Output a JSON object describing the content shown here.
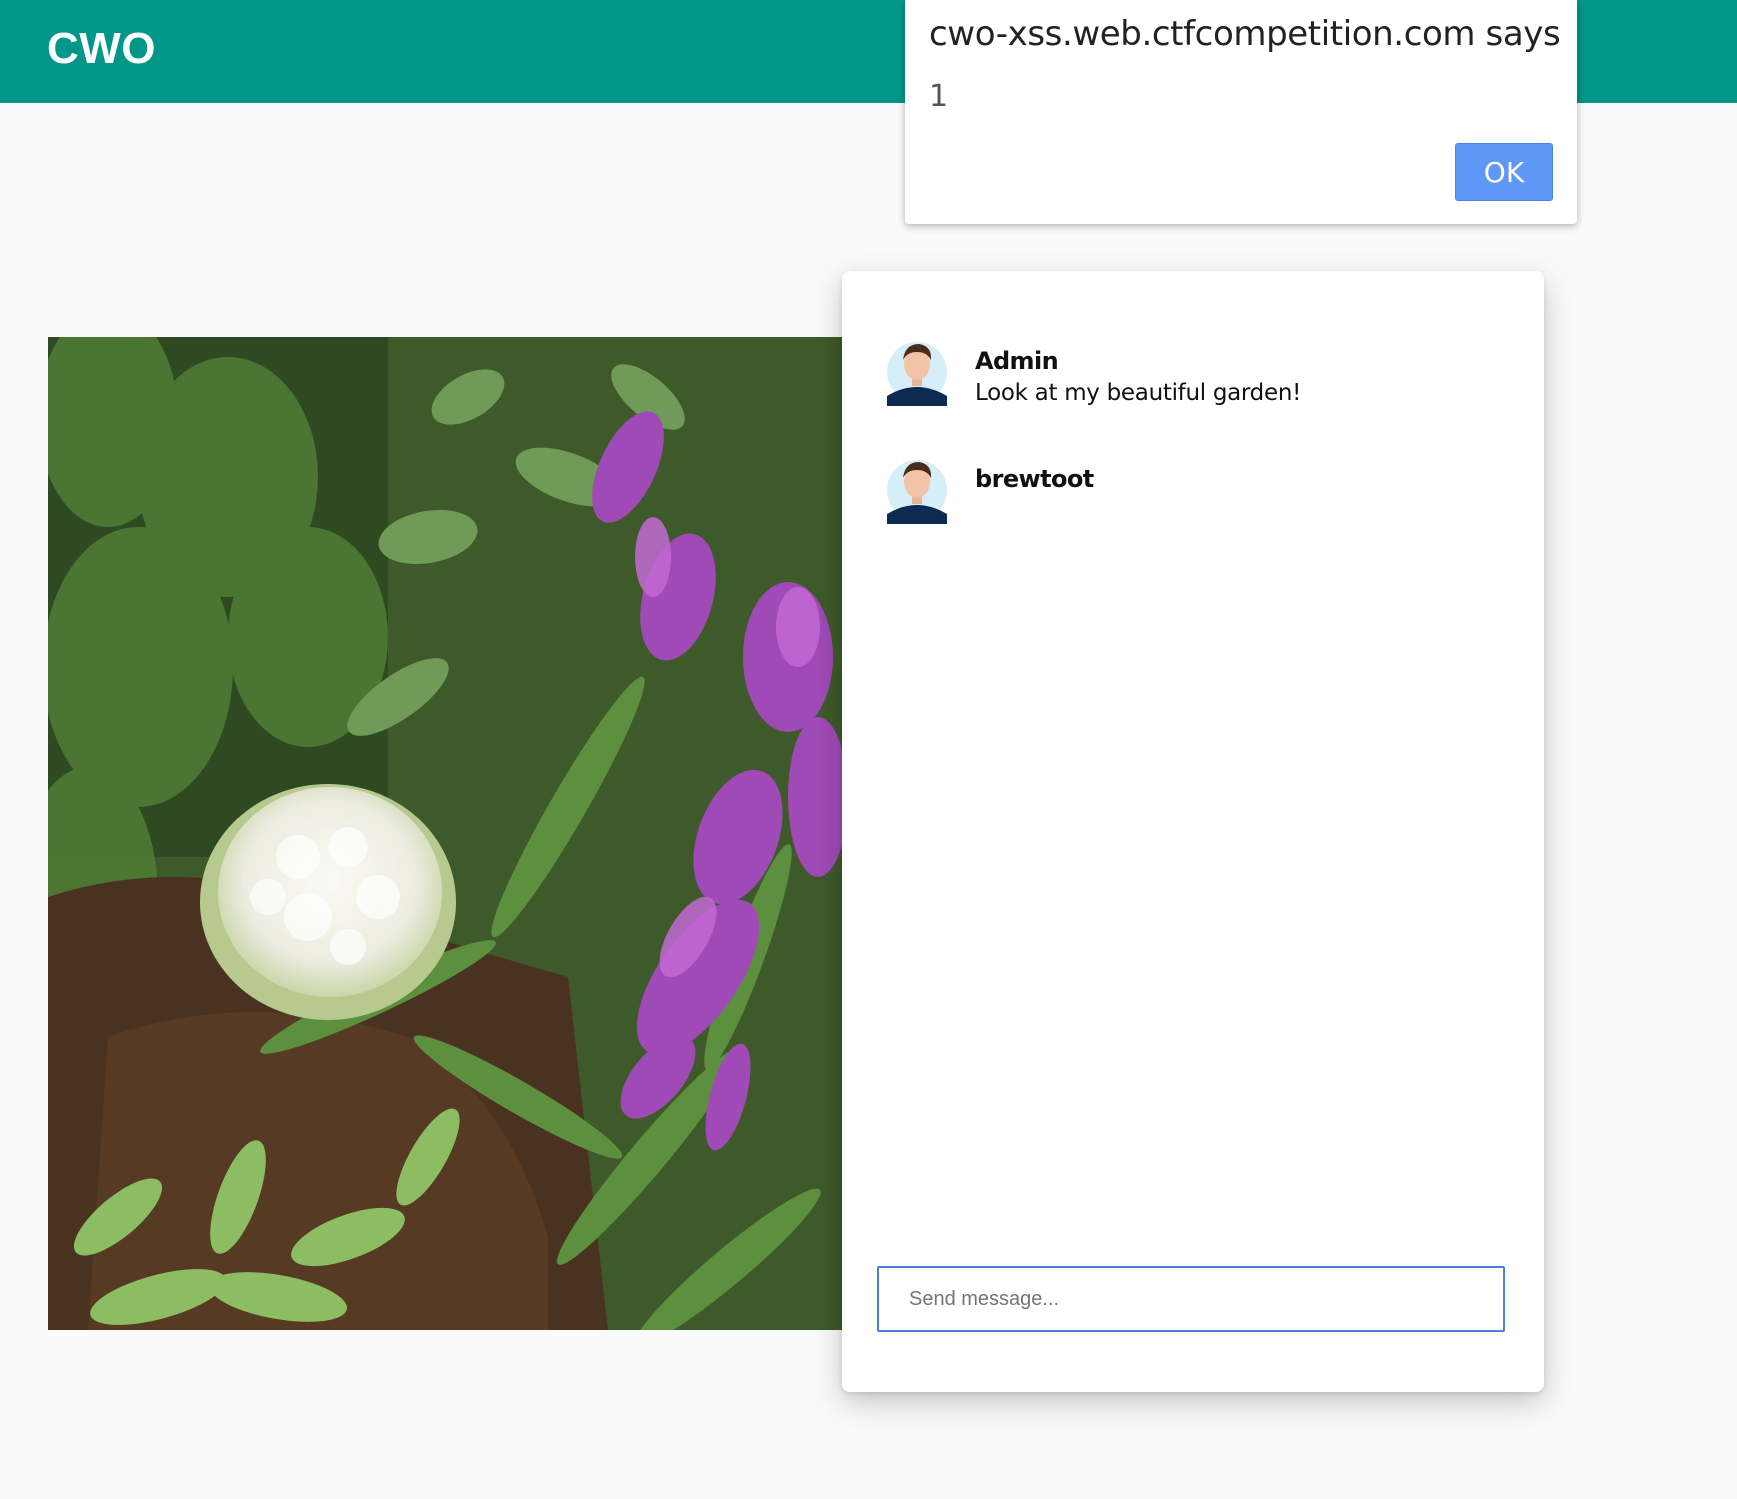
{
  "colors": {
    "brand": "#009688",
    "ok_button": "#5e97f6",
    "input_focus": "#4a7fdc"
  },
  "header": {
    "brand": "CWO"
  },
  "photo": {
    "alt": "",
    "icon": "garden-photo"
  },
  "chat": {
    "messages": [
      {
        "author": "Admin",
        "text": "Look at my beautiful garden!",
        "avatar_icon": "user-avatar-icon"
      },
      {
        "author": "brewtoot",
        "text": "",
        "avatar_icon": "user-avatar-icon"
      }
    ],
    "input": {
      "placeholder": "Send message...",
      "value": ""
    }
  },
  "dialog": {
    "title": "cwo-xss.web.ctfcompetition.com says",
    "message": "1",
    "ok_label": "OK"
  }
}
